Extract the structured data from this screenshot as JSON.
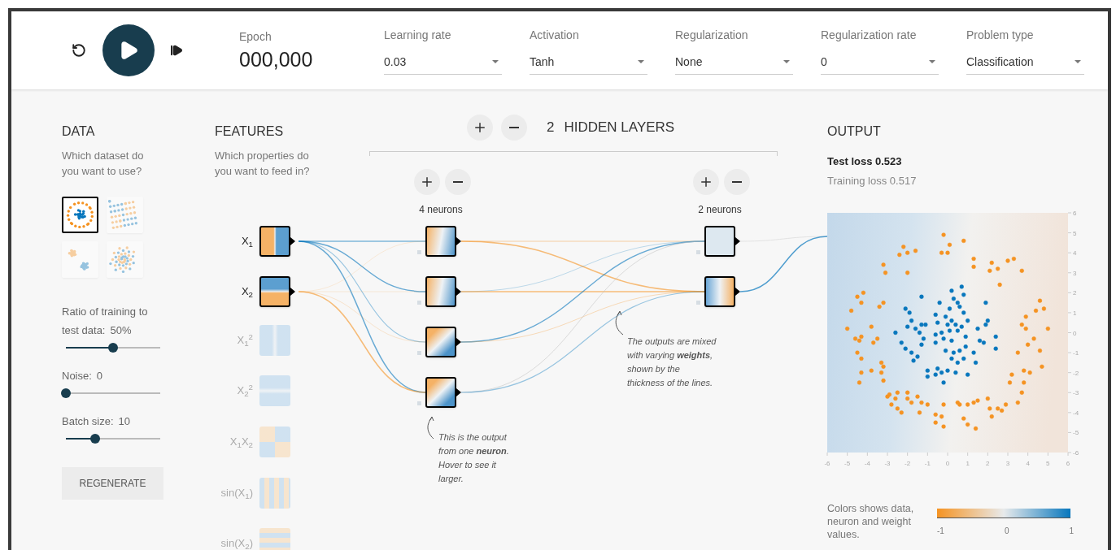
{
  "header": {
    "epoch": {
      "label": "Epoch",
      "value": "000,000"
    },
    "controls": [
      {
        "label": "Learning rate",
        "value": "0.03"
      },
      {
        "label": "Activation",
        "value": "Tanh"
      },
      {
        "label": "Regularization",
        "value": "None"
      },
      {
        "label": "Regularization rate",
        "value": "0"
      },
      {
        "label": "Problem type",
        "value": "Classification"
      }
    ]
  },
  "data": {
    "title": "DATA",
    "subtitle": "Which dataset do you want to use?",
    "datasets": [
      {
        "kind": "circle",
        "selected": true
      },
      {
        "kind": "xor",
        "selected": false
      },
      {
        "kind": "gauss",
        "selected": false
      },
      {
        "kind": "spiral",
        "selected": false
      }
    ],
    "sliders": [
      {
        "label": "Ratio of training to",
        "label_2": "test data:",
        "value": "50%",
        "level": 0.5
      },
      {
        "label": "Noise:",
        "value": "0",
        "level": 0
      },
      {
        "label": "Batch size:",
        "value": "10",
        "level": 0.31
      }
    ],
    "button": "REGENERATE"
  },
  "features": {
    "title": "FEATURES",
    "subtitle": "Which properties do you want to feed in?",
    "items": [
      {
        "label": "X$_{1}$",
        "kind": "x1",
        "active": true
      },
      {
        "label": "X$_{2}$",
        "kind": "x2",
        "active": true
      },
      {
        "label": "X$_{1}$$^{2}$",
        "kind": "x1sq",
        "active": false
      },
      {
        "label": "X$_{2}$$^{2}$",
        "kind": "x2sq",
        "active": false
      },
      {
        "label": "X$_{1}$X$_{2}$",
        "kind": "x1x2",
        "active": false
      },
      {
        "label": "sin(X$_{1}$)",
        "kind": "sin1",
        "active": false
      },
      {
        "label": "sin(X$_{2}$)",
        "kind": "sin2",
        "active": false
      }
    ]
  },
  "hidden_layers": {
    "count": "2",
    "label": "HIDDEN LAYERS",
    "layers": [
      {
        "label": "4 neurons",
        "neurons": [
          {
            "kind": "orange-blue"
          },
          {
            "kind": "orange-blue"
          },
          {
            "kind": "orange-blue-diagonal"
          },
          {
            "kind": "orange-blue-diagonal"
          }
        ]
      },
      {
        "label": "2 neurons",
        "neurons": [
          {
            "kind": "pale"
          },
          {
            "kind": "blue-orange"
          }
        ]
      }
    ],
    "notes": [
      "This is the output from one **neuron**. Hover to see it larger.",
      "The outputs are mixed with varying **weights**, shown by the thickness of the lines."
    ]
  },
  "output": {
    "title": "OUTPUT",
    "test_loss": "Test loss 0.523",
    "training_loss": "Training loss 0.517",
    "chart_data": {
      "type": "scatter",
      "xlim": [
        -6,
        6
      ],
      "ylim": [
        -6,
        6
      ],
      "xticks": [
        {
          "value": -6,
          "label": "-6"
        },
        {
          "value": -5,
          "label": "-5"
        },
        {
          "value": -4,
          "label": "-4"
        },
        {
          "value": -3,
          "label": "-3"
        },
        {
          "value": -2,
          "label": "-2"
        },
        {
          "value": -1,
          "label": "-1"
        },
        {
          "value": 0,
          "label": "0"
        },
        {
          "value": 1,
          "label": "1"
        },
        {
          "value": 2,
          "label": "2"
        },
        {
          "value": 3,
          "label": "3"
        },
        {
          "value": 4,
          "label": "4"
        },
        {
          "value": 5,
          "label": "5"
        },
        {
          "value": 6,
          "label": "6"
        }
      ],
      "yticks": [
        {
          "value": -6,
          "label": "-6"
        },
        {
          "value": -5,
          "label": "-5"
        },
        {
          "value": -4,
          "label": "-4"
        },
        {
          "value": -3,
          "label": "-3"
        },
        {
          "value": -2,
          "label": "-2"
        },
        {
          "value": -1,
          "label": "-1"
        },
        {
          "value": 0,
          "label": "0"
        },
        {
          "value": 1,
          "label": "1"
        },
        {
          "value": 2,
          "label": "2"
        },
        {
          "value": 3,
          "label": "3"
        },
        {
          "value": 4,
          "label": "4"
        },
        {
          "value": 5,
          "label": "5"
        },
        {
          "value": 6,
          "label": "6"
        }
      ],
      "series": [
        {
          "color": "#f59322",
          "x": [
            -0.2,
            0.1,
            0.8,
            -1.6,
            -0.3,
            0,
            -2.2,
            -2.0,
            -2.4,
            -2.0,
            -3.2,
            -3.1,
            1.3,
            1.3,
            2.2,
            2.1,
            2.5,
            3.0,
            3.3,
            3.7,
            2.6,
            -4.5,
            -4.2,
            -4.3,
            -4.8,
            -3.4,
            -3.2,
            -5.0,
            -3.8,
            -4.6,
            -4.3,
            -4.4,
            -3.7,
            -3.5,
            -4.5,
            -4.3,
            -3.3,
            -3.2,
            -4.3,
            -3.8,
            -3.3,
            -3.2,
            -4.4,
            4.6,
            4.8,
            4.4,
            3.9,
            3.7,
            3.9,
            5.0,
            4.3,
            4.0,
            4.6,
            3.5,
            4.7,
            3.8,
            4.1,
            3.2,
            3.1,
            3.8,
            3.7,
            3.5,
            2.9,
            2.7,
            2.5,
            2.0,
            2.1,
            2.2,
            1.5,
            1.3,
            1.0,
            0.6,
            0.5,
            0.8,
            1.0,
            1.4,
            -0.2,
            -0.3,
            -0.6,
            -0.6,
            -0.2,
            -1.0,
            -1.3,
            -1.5,
            -1.8,
            -2.0,
            -2.0,
            -2.5,
            -2.6,
            -2.9,
            -3.0,
            -2.8,
            -2.5,
            -2.3,
            -1.4
          ],
          "values": [
            4.9,
            4.4,
            4.6,
            4.1,
            4.0,
            4.0,
            4.3,
            4.0,
            3.9,
            3.0,
            3.4,
            3.0,
            3.7,
            3.3,
            3.5,
            3.1,
            3.2,
            3.6,
            3.7,
            3.1,
            2.4,
            1.8,
            2.0,
            1.5,
            1.1,
            1.3,
            1.5,
            0.2,
            0.3,
            -0.3,
            -0.2,
            -0.4,
            -0.5,
            -0.3,
            -1.0,
            -1.3,
            -1.5,
            -1.7,
            -2.0,
            -1.9,
            -2.0,
            -2.4,
            -2.5,
            1.6,
            1.2,
            1.1,
            0.8,
            0.4,
            0.2,
            0.2,
            -0.3,
            -0.6,
            -0.9,
            -1.0,
            -1.7,
            -1.9,
            -2.0,
            -2.1,
            -2.5,
            -2.5,
            -3.0,
            -3.5,
            -3.6,
            -3.9,
            -3.8,
            -3.3,
            -3.8,
            -4.2,
            -3.4,
            -3.5,
            -3.6,
            -3.6,
            -3.5,
            -4.3,
            -4.6,
            -4.8,
            -3.6,
            -4.2,
            -4.1,
            -4.5,
            -4.7,
            -3.6,
            -3.5,
            -3.2,
            -3.5,
            -3.0,
            -3.3,
            -3.0,
            -3.3,
            -3.1,
            -3.2,
            -3.6,
            -3.8,
            -4.0,
            -4.0
          ]
        },
        {
          "color": "#0877bd",
          "x": [
            0.7,
            0.2,
            0.8,
            0.3,
            0.5,
            0.6,
            0.8,
            -1.3,
            -0.4,
            1.9,
            0.1,
            -2.1,
            -1.9,
            -1.8,
            -0.6,
            -0.1,
            0.2,
            1.0,
            2.0,
            1.9,
            -2.0,
            -1.6,
            -1.3,
            -1.1,
            -0.5,
            0.0,
            0.4,
            0.7,
            1.5,
            -2.6,
            -1.4,
            -0.6,
            -0.3,
            0.1,
            0.5,
            0.9,
            2.4,
            -1.2,
            -0.6,
            -0.2,
            0.2,
            1.6,
            1.8,
            -2.3,
            -1.3,
            0.9,
            2.4,
            -2.1,
            -1.8,
            -1.5,
            -0.1,
            0.3,
            0.6,
            1.3,
            -1.7,
            0.2,
            0.5,
            0.8,
            1.4,
            -0.5,
            -0.3,
            0.0,
            0.4,
            -1.0,
            -0.6,
            -1.0,
            1.0,
            -0.2
          ],
          "values": [
            2.3,
            2.1,
            1.9,
            1.7,
            1.5,
            1.3,
            1.0,
            1.8,
            1.5,
            1.5,
            1.2,
            1.2,
            1.0,
            0.6,
            0.9,
            0.8,
            0.6,
            0.6,
            0.6,
            0.4,
            0.3,
            0.2,
            0.4,
            0.4,
            0.5,
            0.4,
            0.4,
            0.3,
            0.2,
            0.0,
            0.0,
            -0.1,
            0.0,
            0.1,
            0.1,
            -0.2,
            -0.2,
            -0.3,
            -0.5,
            -0.3,
            -0.4,
            -0.4,
            -0.5,
            -0.5,
            -0.6,
            -0.7,
            -0.8,
            -0.8,
            -1.0,
            -1.2,
            -0.9,
            -1.0,
            -0.9,
            -1.0,
            -1.4,
            -1.3,
            -1.5,
            -1.3,
            -1.5,
            -1.8,
            -2.0,
            -1.9,
            -2.0,
            -1.9,
            -2.1,
            -2.2,
            -2.1,
            -2.5
          ]
        }
      ]
    },
    "legend": {
      "text": "Colors shows data, neuron and weight values.",
      "ticks": [
        "-1",
        "0",
        "1"
      ]
    }
  }
}
